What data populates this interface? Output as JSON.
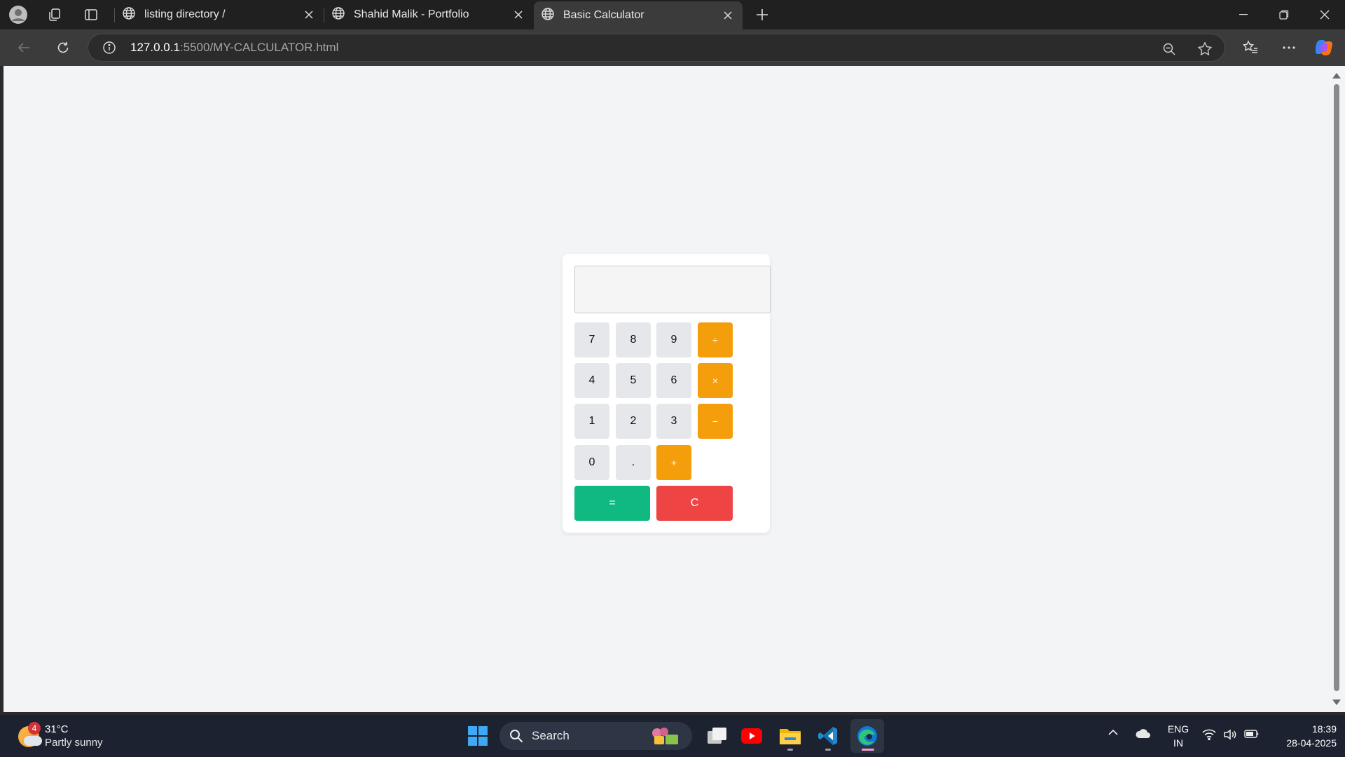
{
  "browser": {
    "tabs": [
      {
        "title": "listing directory /",
        "active": false
      },
      {
        "title": "Shahid Malik - Portfolio",
        "active": false
      },
      {
        "title": "Basic Calculator",
        "active": true
      }
    ],
    "address": {
      "host": "127.0.0.1",
      "path": ":5500/MY-CALCULATOR.html"
    }
  },
  "calculator": {
    "display_value": "",
    "keys": {
      "k7": "7",
      "k8": "8",
      "k9": "9",
      "divide": "÷",
      "k4": "4",
      "k5": "5",
      "k6": "6",
      "multiply": "×",
      "k1": "1",
      "k2": "2",
      "k3": "3",
      "subtract": "−",
      "k0": "0",
      "dot": ".",
      "add": "+",
      "equals": "=",
      "clear": "C"
    },
    "colors": {
      "digit": "#e5e7eb",
      "operator": "#f59e0b",
      "equals": "#10b981",
      "clear": "#ef4444",
      "page_bg": "#f3f4f6"
    }
  },
  "taskbar": {
    "weather": {
      "badge": "4",
      "temp": "31°C",
      "condition": "Partly sunny"
    },
    "search_label": "Search",
    "apps": [
      "task-view",
      "youtube",
      "file-explorer",
      "vscode",
      "edge"
    ],
    "language": {
      "line1": "ENG",
      "line2": "IN"
    },
    "clock": {
      "time": "18:39",
      "date": "28-04-2025"
    }
  }
}
